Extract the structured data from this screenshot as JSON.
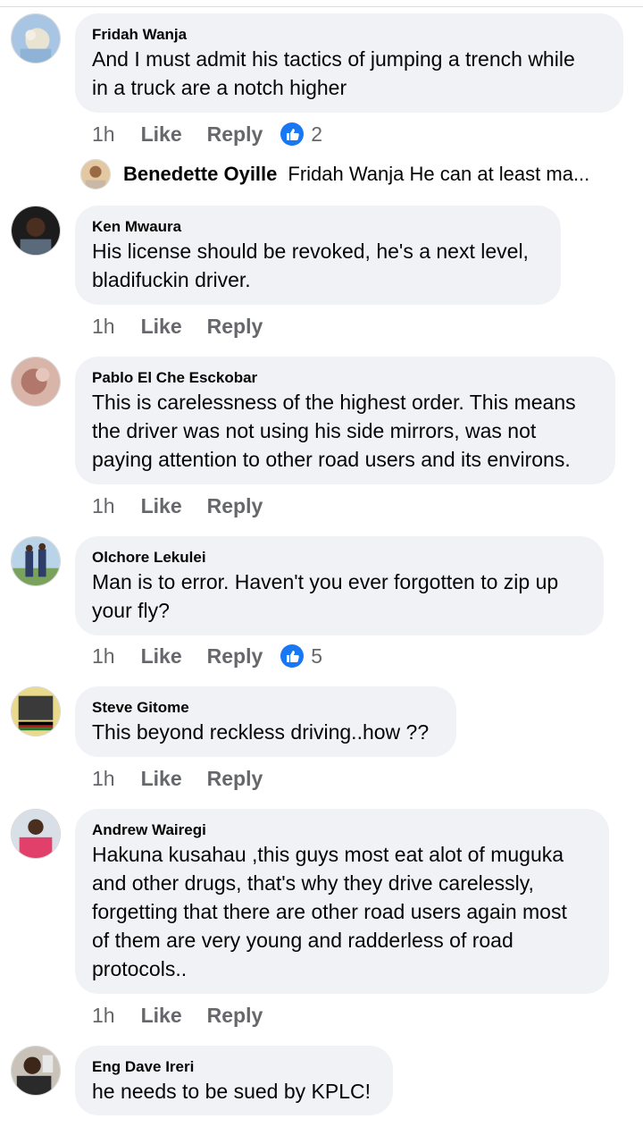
{
  "comments": [
    {
      "author": "Fridah Wanja",
      "lines": [
        "And I must admit his tactics of jumping a trench while",
        "in a truck are a notch higher"
      ],
      "time": "1h",
      "like": "Like",
      "reply": "Reply",
      "reactions": "2"
    },
    {
      "author": "Ken Mwaura",
      "lines": [
        "His license should be revoked, he's a next level,",
        "bladifuckin driver."
      ],
      "time": "1h",
      "like": "Like",
      "reply": "Reply"
    },
    {
      "author": "Pablo El Che Esckobar",
      "lines": [
        "This is carelessness of the highest order. This means",
        "the driver was not using his side mirrors, was not",
        "paying attention to other road users and its environs."
      ],
      "time": "1h",
      "like": "Like",
      "reply": "Reply"
    },
    {
      "author": "Olchore Lekulei",
      "lines": [
        "Man is to error. Haven't  you ever forgotten to zip up",
        "your fly?"
      ],
      "time": "1h",
      "like": "Like",
      "reply": "Reply",
      "reactions": "5"
    },
    {
      "author": "Steve Gitome",
      "lines": [
        "This beyond reckless driving..how ??"
      ],
      "time": "1h",
      "like": "Like",
      "reply": "Reply"
    },
    {
      "author": "Andrew Wairegi",
      "lines": [
        "Hakuna kusahau ,this guys most eat alot of muguka",
        "and other drugs, that's why they drive carelessly,",
        "forgetting that there are other road users again most",
        "of them are very young and radderless of road",
        "protocols.."
      ],
      "time": "1h",
      "like": "Like",
      "reply": "Reply"
    },
    {
      "author": "Eng Dave Ireri",
      "lines": [
        "he needs to be sued by KPLC!"
      ]
    }
  ],
  "reply_preview": {
    "author": "Benedette Oyille",
    "text": "Fridah Wanja He can at least ma..."
  },
  "colors": {
    "bubble": "#f0f2f5",
    "meta_text": "#65676b",
    "like_blue": "#1877f2"
  }
}
